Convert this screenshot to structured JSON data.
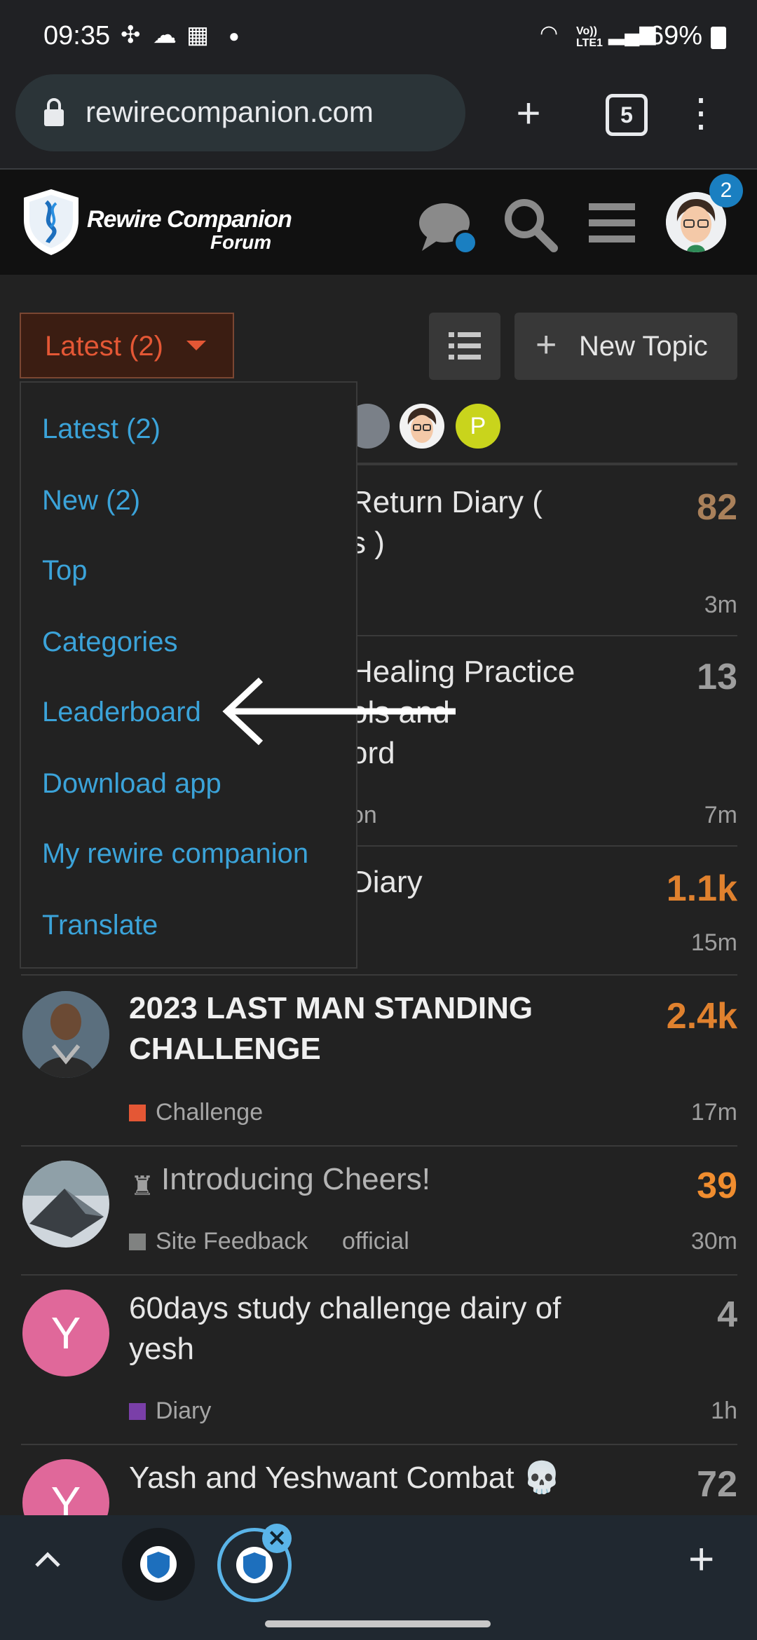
{
  "status_bar": {
    "time": "09:35",
    "battery": "69%",
    "net_label": "Vo)) LTE1"
  },
  "browser": {
    "url": "rewirecompanion.com",
    "tab_count": "5"
  },
  "forum": {
    "logo_title": "Rewire Companion",
    "logo_sub": "Forum",
    "notification_count": "2"
  },
  "nav": {
    "dropdown_label": "Latest (2)",
    "new_topic": "New Topic",
    "menu_items": [
      "Latest (2)",
      "New (2)",
      "Top",
      "Categories",
      "Leaderboard",
      "Download app",
      "My rewire companion",
      "Translate"
    ]
  },
  "posters": {
    "p_letter": "P"
  },
  "topics": [
    {
      "title_visible": "Return Diary (\ns )",
      "count": "82",
      "age": "3m"
    },
    {
      "title_visible": "Healing Practice\nols and\nord",
      "sub": "on",
      "count": "13",
      "age": "7m"
    },
    {
      "title_visible": "Diary",
      "count": "1.1k",
      "age": "15m"
    },
    {
      "title": "2023 LAST MAN STANDING CHALLENGE",
      "category": "Challenge",
      "count": "2.4k",
      "age": "17m"
    },
    {
      "title": "Introducing Cheers!",
      "category": "Site Feedback",
      "tag": "official",
      "count": "39",
      "age": "30m"
    },
    {
      "title": "60days study challenge dairy of yesh",
      "category": "Diary",
      "avatar_letter": "Y",
      "count": "4",
      "age": "1h"
    },
    {
      "title": "Yash and Yeshwant Combat 💀",
      "avatar_letter": "Y",
      "count": "72"
    }
  ],
  "colors": {
    "accent": "#e45735",
    "link": "#3ba3d9",
    "count_hot": "#e0812e",
    "count_warm": "#f08d2f",
    "count_brown": "#a9805a",
    "cat_challenge": "#e45735",
    "cat_feedback": "#808281",
    "cat_diary": "#7a3fa8"
  }
}
